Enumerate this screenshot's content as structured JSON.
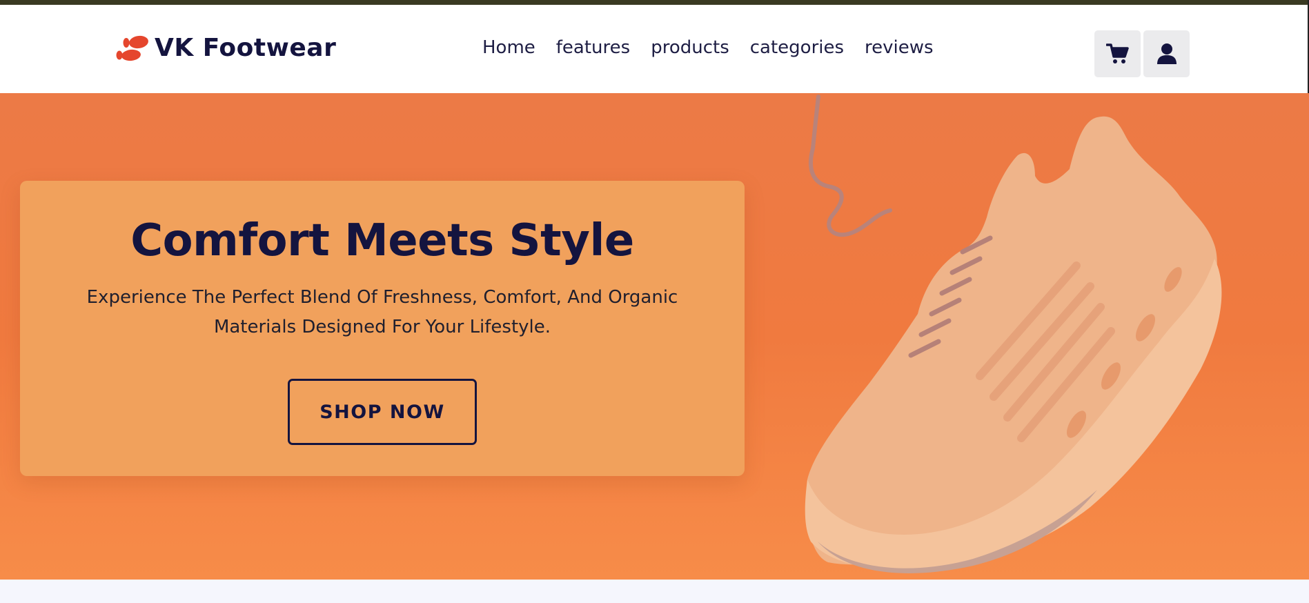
{
  "brand": {
    "name": "VK Footwear",
    "icon": "footprints-icon",
    "accent_color": "#e5462d",
    "text_color": "#14143f"
  },
  "nav": {
    "links": [
      "Home",
      "features",
      "products",
      "categories",
      "reviews"
    ]
  },
  "header_actions": {
    "cart_icon": "shopping-cart-icon",
    "user_icon": "user-icon"
  },
  "hero": {
    "title": "Comfort Meets Style",
    "text": "Experience The Perfect Blend Of Freshness, Comfort, And Organic Materials Designed For Your Lifestyle.",
    "button_label": "SHOP NOW",
    "background_color": "#f07a3f",
    "card_color": "#f1a15c",
    "image": "sneaker-image"
  }
}
